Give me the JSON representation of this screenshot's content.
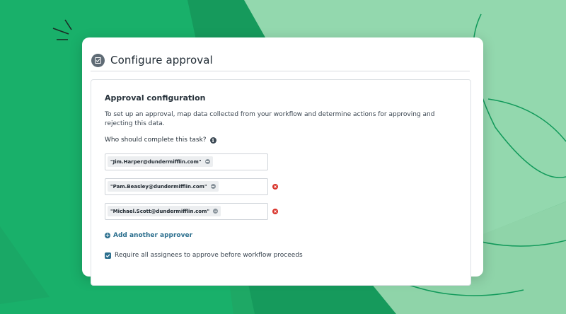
{
  "header": {
    "title": "Configure approval"
  },
  "section": {
    "title": "Approval configuration",
    "description": "To set up an approval, map data collected from your workflow and determine actions for approving and rejecting this data.",
    "question": "Who should complete this task?"
  },
  "approvers": [
    {
      "email": "\"Jim.Harper@dundermifflin.com\""
    },
    {
      "email": "\"Pam.Beasley@dundermifflin.com\""
    },
    {
      "email": "\"Michael.Scott@dundermifflin.com\""
    }
  ],
  "actions": {
    "add_approver": "Add another approver"
  },
  "options": {
    "require_all_label": "Require all assignees to approve before workflow proceeds",
    "require_all_checked": true
  },
  "colors": {
    "accent": "#2c6f8e",
    "background_green": "#1a9e5f",
    "delete_red": "#d9342b"
  },
  "icons": {
    "header": "checklist-icon",
    "info": "info-icon",
    "delete": "close-circle-icon",
    "add": "plus-circle-icon"
  }
}
